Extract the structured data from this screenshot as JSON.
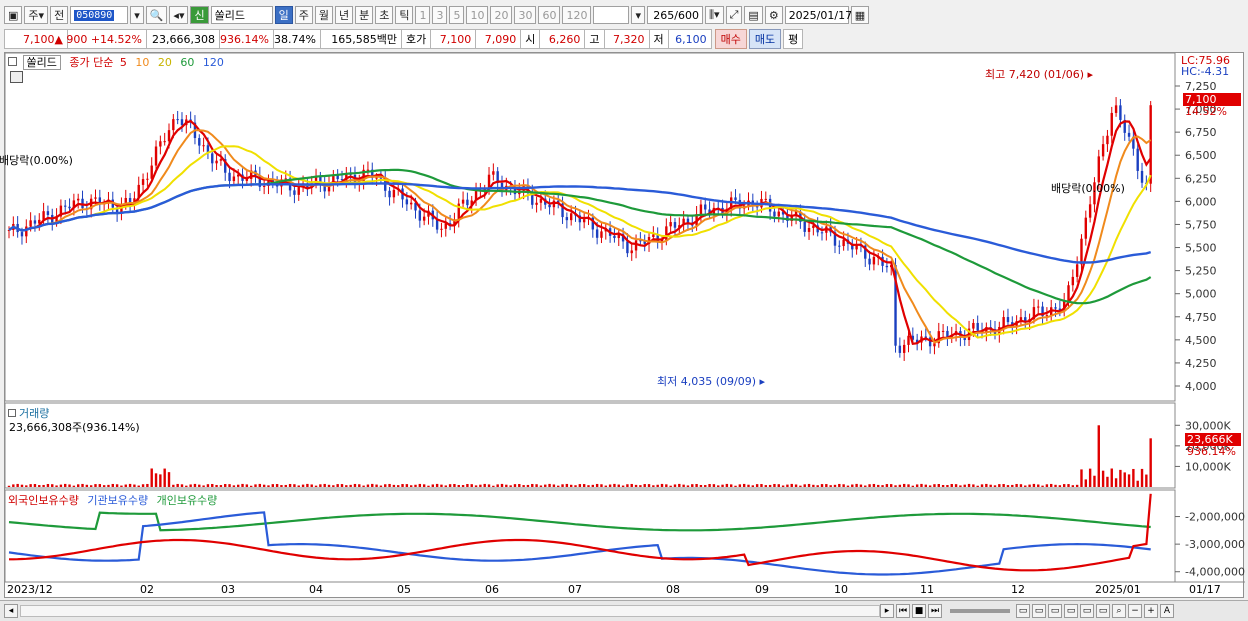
{
  "toolbar": {
    "type_label": "주",
    "prev_label": "전",
    "stock_code": "050890",
    "name_badge": "신",
    "stock_name": "쏠리드",
    "periods": [
      "일",
      "주",
      "월",
      "년",
      "분",
      "초",
      "틱"
    ],
    "intervals": [
      "1",
      "3",
      "5",
      "10",
      "20",
      "30",
      "60",
      "120"
    ],
    "count": "265",
    "count_total": "/600",
    "date": "2025/01/17"
  },
  "quote": {
    "price": "7,100",
    "change": "900",
    "change_pct": "+14.52%",
    "volume": "23,666,308",
    "vol_ratio": "936.14%",
    "turnover": "38.74%",
    "amount": "165,585백만",
    "hoga_label": "호가",
    "ask": "7,100",
    "bid": "7,090",
    "open_label": "시",
    "open": "6,260",
    "high_label": "고",
    "high": "7,320",
    "low_label": "저",
    "low": "6,100",
    "buy_label": "매수",
    "sell_label": "매도",
    "eval_label": "평"
  },
  "price_pane": {
    "name": "쏠리드",
    "ma_label": "종가 단순",
    "ma_periods": [
      "5",
      "10",
      "20",
      "60",
      "120"
    ],
    "lc": "LC:75.96",
    "hc": "HC:-4.31",
    "last_tag": "7,100",
    "last_pct": "14.52%",
    "high_note": "최고 7,420 (01/06)",
    "low_note": "최저 4,035 (09/09)",
    "div_left": "배당락(0.00%)",
    "div_right": "배당락(0.00%)",
    "yticks": [
      "7,250",
      "7,000",
      "6,750",
      "6,500",
      "6,250",
      "6,000",
      "5,750",
      "5,500",
      "5,250",
      "5,000",
      "4,750",
      "4,500",
      "4,250",
      "4,000"
    ]
  },
  "volume_pane": {
    "title": "거래량",
    "value": "23,666,308주(936.14%)",
    "yticks": [
      "30,000K",
      "20,000K",
      "10,000K"
    ],
    "last_tag": "23,666K",
    "last_pct": "936.14%"
  },
  "holding_pane": {
    "foreign": "외국인보유수량",
    "institution": "기관보유수량",
    "individual": "개인보유수량",
    "yticks": [
      "-2,000,000",
      "-3,000,000",
      "-4,000,000"
    ]
  },
  "xaxis": [
    "2023/12",
    "02",
    "03",
    "04",
    "05",
    "06",
    "07",
    "08",
    "09",
    "10",
    "11",
    "12",
    "2025/01",
    "01/17"
  ],
  "colors": {
    "ma5": "#e00000",
    "ma10": "#f08a1c",
    "ma20": "#f0e000",
    "ma60": "#1e9a3a",
    "ma120": "#2a5bd8",
    "up": "#e00000",
    "down": "#1a3fc0"
  }
}
